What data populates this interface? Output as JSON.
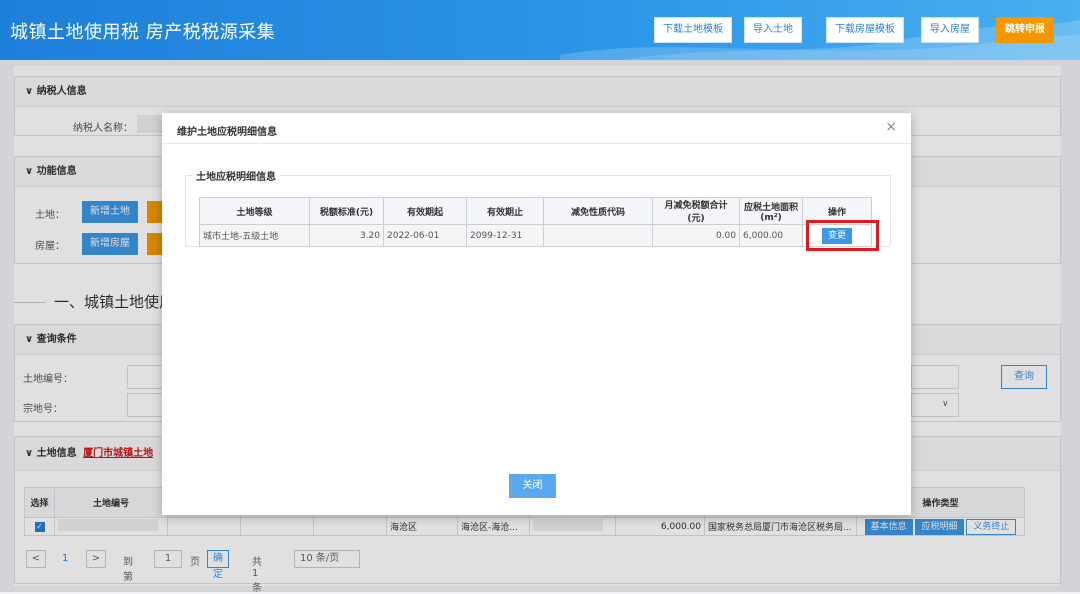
{
  "header": {
    "title": "城镇土地使用税 房产税税源采集",
    "buttons": [
      "下载土地模板",
      "导入土地",
      "下载房屋模板",
      "导入房屋",
      "跳转申报"
    ]
  },
  "taxpayer": {
    "section": "∨ 纳税人信息",
    "name_label": "纳税人名称："
  },
  "function": {
    "section": "∨ 功能信息",
    "land_label": "土地：",
    "land_button": "新增土地",
    "house_label": "房屋：",
    "house_button": "新增房屋"
  },
  "section_title": "一、城镇土地使用税",
  "query": {
    "section": "∨ 查询条件",
    "land_no_label": "土地编号：",
    "parcel_no_label": "宗地号：",
    "query_button": "查询",
    "chevron": "∨"
  },
  "land_info": {
    "section": "∨ 土地信息",
    "link": "厦门市城镇土地"
  },
  "grid": {
    "headers": [
      "选择",
      "土地编号",
      "",
      "",
      "",
      "",
      "",
      "",
      "",
      "",
      "操作类型"
    ],
    "row": {
      "district": "海沧区",
      "street": "海沧区-海沧...",
      "area": "6,000.00",
      "authority": "国家税务总局厦门市海沧区税务局...",
      "actions": [
        "基本信息",
        "应税明细",
        "义务终止"
      ]
    }
  },
  "pagination": {
    "prev": "<",
    "page": "1",
    "next": ">",
    "goto_label": "到第",
    "goto_value": "1",
    "page_unit": "页",
    "confirm": "确定",
    "total": "共 1 条",
    "per_page": "10 条/页"
  },
  "modal": {
    "title": "维护土地应税明细信息",
    "close_x": "×",
    "legend": "土地应税明细信息",
    "columns": [
      "土地等级",
      "税额标准(元)",
      "有效期起",
      "有效期止",
      "减免性质代码",
      "月减免税额合计(元)",
      "应税土地面积(m²)",
      "操作"
    ],
    "rows": [
      {
        "grade": "城市土地-五级土地",
        "rate": "3.20",
        "start": "2022-06-01",
        "end": "2099-12-31",
        "code": "",
        "relief": "0.00",
        "area": "6,000.00",
        "action": "变更"
      }
    ],
    "close_button": "关闭"
  },
  "colors": {
    "header": "#2b95e8",
    "primary": "#3c97e6",
    "orange": "#f39800",
    "highlight": "#e21a1a"
  }
}
